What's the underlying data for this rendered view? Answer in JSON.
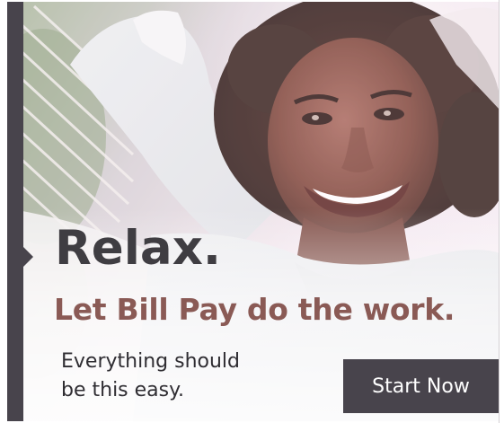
{
  "ad": {
    "headline": "Relax.",
    "subheadline": "Let Bill Pay do the work.",
    "tagline_line1": "Everything should",
    "tagline_line2": "be this easy.",
    "cta_label": "Start Now"
  },
  "colors": {
    "dark_bar": "#48444c",
    "headline": "#3f3d42",
    "subheadline": "#8a5a55",
    "cta_background": "#48444c",
    "cta_text": "#ffffff"
  }
}
